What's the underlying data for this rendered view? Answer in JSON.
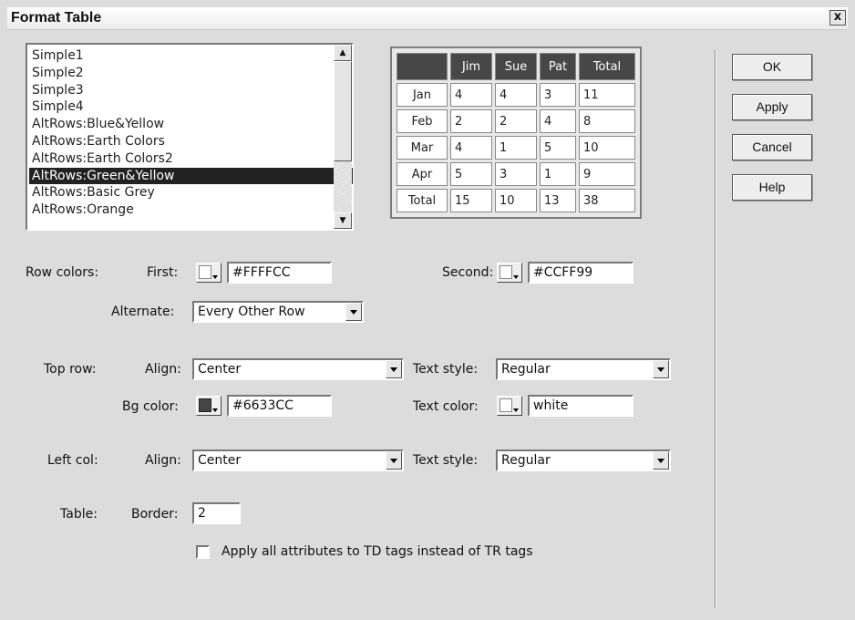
{
  "window": {
    "title": "Format Table",
    "close_label": "x"
  },
  "styles_list": {
    "items": [
      "Simple1",
      "Simple2",
      "Simple3",
      "Simple4",
      "AltRows:Blue&Yellow",
      "AltRows:Earth Colors",
      "AltRows:Earth Colors2",
      "AltRows:Green&Yellow",
      "AltRows:Basic Grey",
      "AltRows:Orange"
    ],
    "selected": "AltRows:Green&Yellow"
  },
  "preview": {
    "header": [
      "",
      "Jim",
      "Sue",
      "Pat",
      "Total"
    ],
    "rows": [
      [
        "Jan",
        "4",
        "4",
        "3",
        "11"
      ],
      [
        "Feb",
        "2",
        "2",
        "4",
        "8"
      ],
      [
        "Mar",
        "4",
        "1",
        "5",
        "10"
      ],
      [
        "Apr",
        "5",
        "3",
        "1",
        "9"
      ],
      [
        "Total",
        "15",
        "10",
        "13",
        "38"
      ]
    ]
  },
  "buttons": {
    "ok": "OK",
    "apply": "Apply",
    "cancel": "Cancel",
    "help": "Help"
  },
  "row_colors": {
    "label": "Row colors:",
    "first_label": "First:",
    "first_value": "#FFFFCC",
    "second_label": "Second:",
    "second_value": "#CCFF99",
    "alternate_label": "Alternate:",
    "alternate_value": "Every Other Row"
  },
  "top_row": {
    "label": "Top row:",
    "align_label": "Align:",
    "align_value": "Center",
    "text_style_label": "Text style:",
    "text_style_value": "Regular",
    "bg_color_label": "Bg color:",
    "bg_color_value": "#6633CC",
    "text_color_label": "Text color:",
    "text_color_value": "white"
  },
  "left_col": {
    "label": "Left col:",
    "align_label": "Align:",
    "align_value": "Center",
    "text_style_label": "Text style:",
    "text_style_value": "Regular"
  },
  "table": {
    "label": "Table:",
    "border_label": "Border:",
    "border_value": "2"
  },
  "apply_td_checkbox": {
    "label": "Apply all attributes to TD tags instead of TR tags",
    "checked": false
  },
  "icons": [
    "close-icon",
    "scroll-up-icon",
    "scroll-down-icon",
    "color-picker-icon",
    "dropdown-arrow-icon"
  ]
}
